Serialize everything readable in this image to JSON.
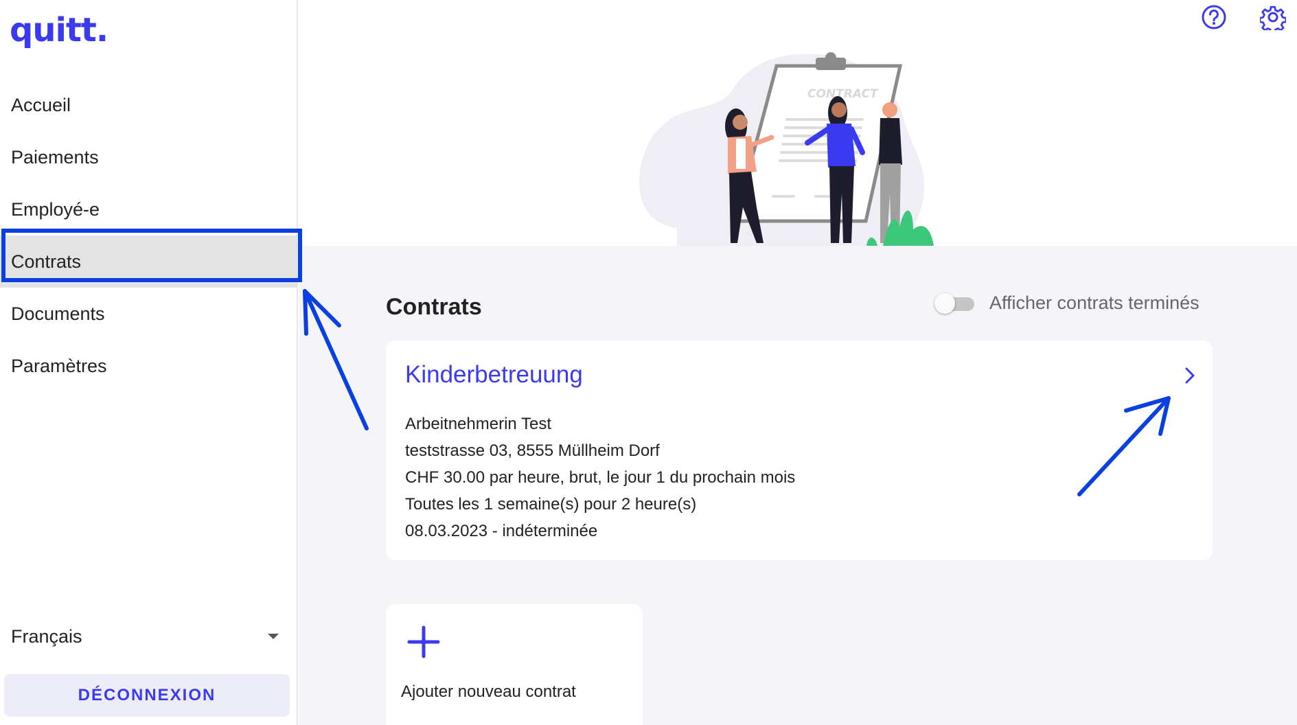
{
  "app": {
    "logo": "quitt."
  },
  "sidebar": {
    "items": [
      {
        "label": "Accueil"
      },
      {
        "label": "Paiements"
      },
      {
        "label": "Employé-e"
      },
      {
        "label": "Contrats",
        "active": true
      },
      {
        "label": "Documents"
      },
      {
        "label": "Paramètres"
      }
    ],
    "language": "Français",
    "logout": "DÉCONNEXION"
  },
  "header": {
    "icons": [
      "help-icon",
      "settings-icon"
    ],
    "illustration_text": "CONTRACT"
  },
  "main": {
    "title": "Contrats",
    "toggle": {
      "label": "Afficher contrats terminés",
      "on": false
    },
    "contract": {
      "title": "Kinderbetreuung",
      "lines": [
        "Arbeitnehmerin Test",
        "teststrasse 03, 8555 Müllheim Dorf",
        "CHF 30.00 par heure, brut, le jour 1 du prochain mois",
        "Toutes les 1 semaine(s) pour 2 heure(s)",
        "08.03.2023 - indéterminée"
      ]
    },
    "add": {
      "label": "Ajouter nouveau contrat"
    }
  },
  "colors": {
    "accent": "#3a3af0",
    "annotation": "#0a3fe0",
    "background": "#f5f5f9"
  }
}
